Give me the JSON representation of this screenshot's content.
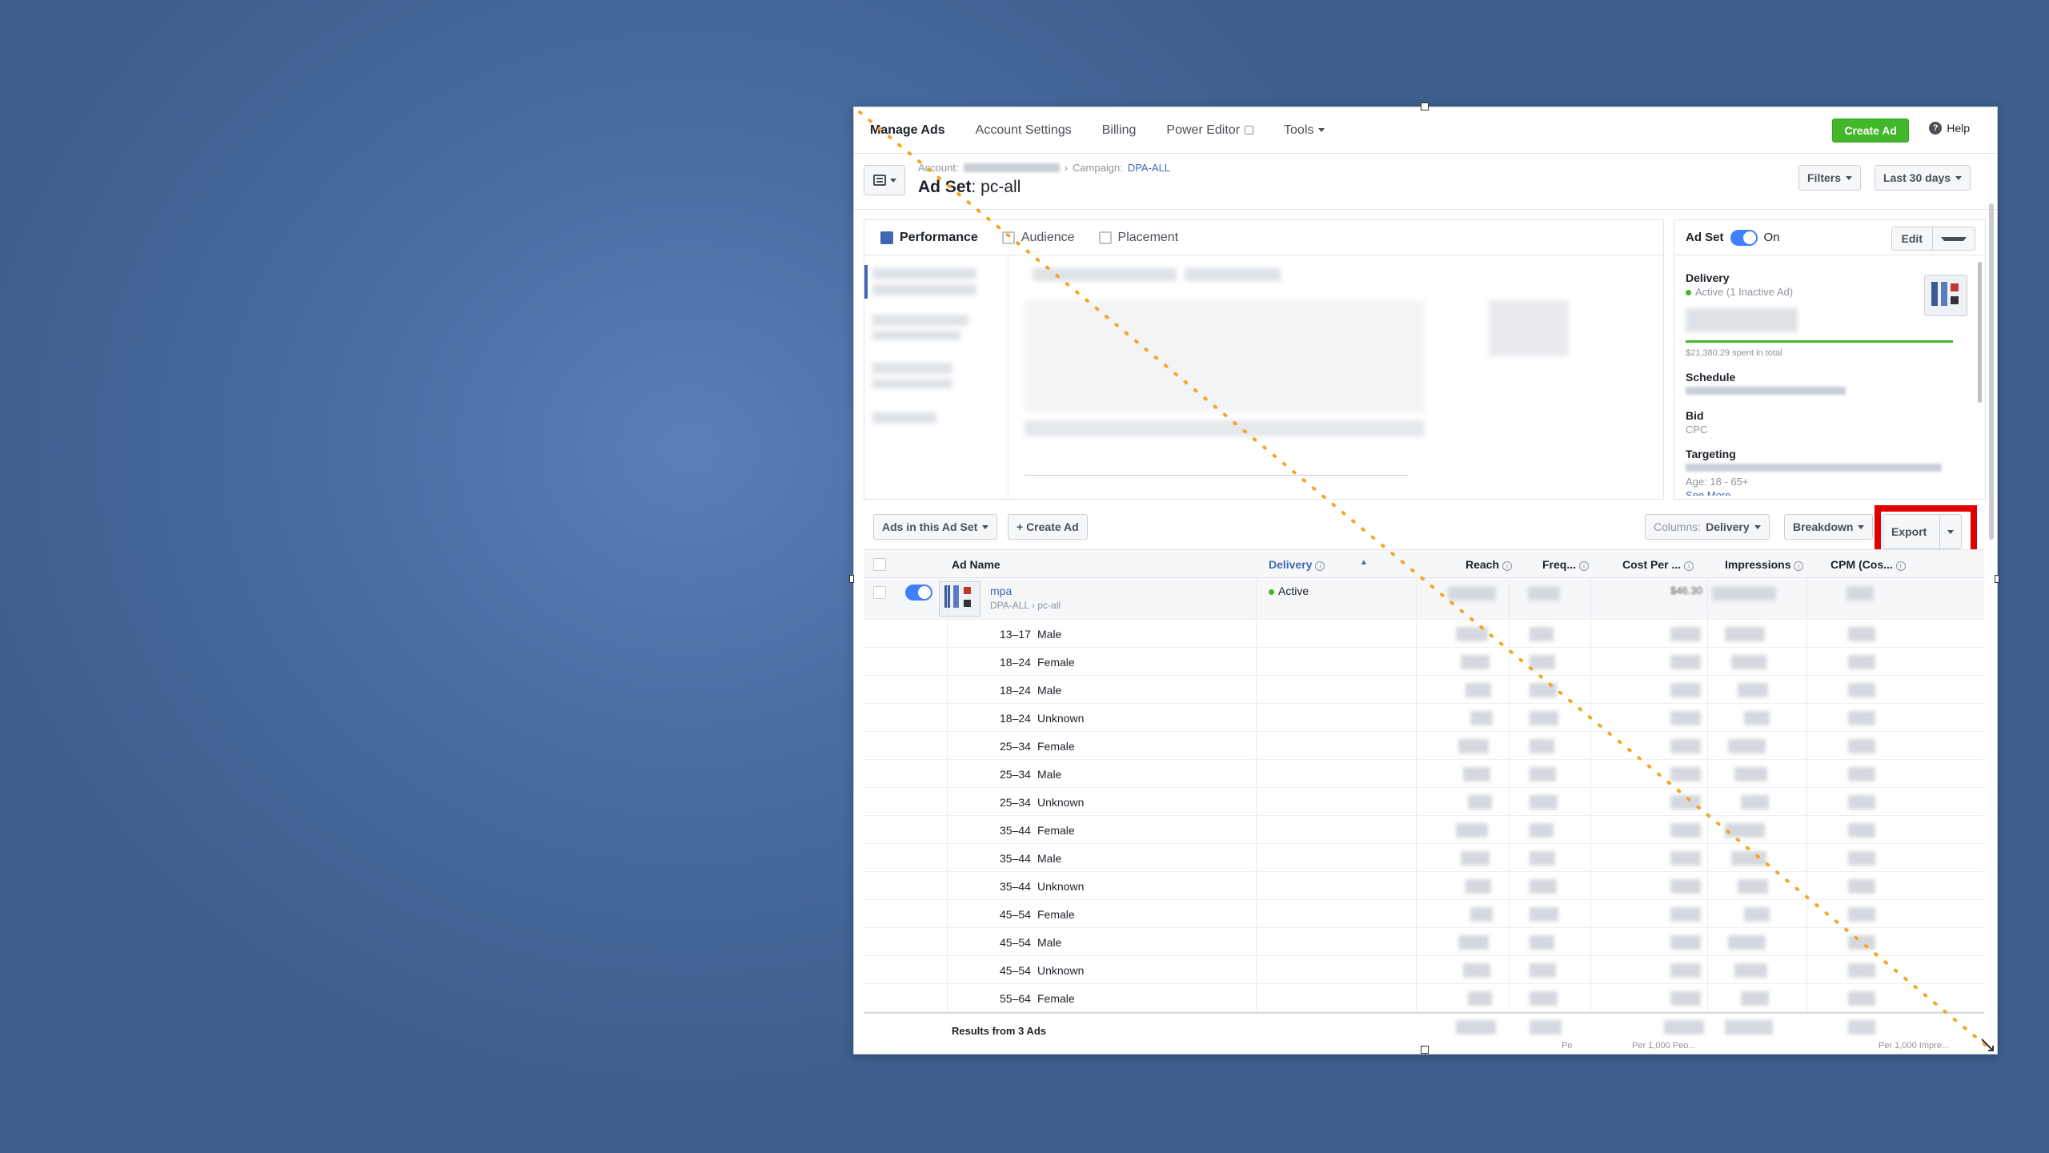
{
  "nav": {
    "items": [
      "Manage Ads",
      "Account Settings",
      "Billing",
      "Power Editor",
      "Tools"
    ],
    "create_ad": "Create Ad",
    "help": "Help"
  },
  "header": {
    "account_label": "Account:",
    "campaign_label": "Campaign:",
    "campaign_name": "DPA-ALL",
    "adset_label": "Ad Set",
    "adset_name": ": pc-all",
    "filters": "Filters",
    "date_range": "Last 30 days"
  },
  "tabs": [
    "Performance",
    "Audience",
    "Placement"
  ],
  "sidebar": {
    "title": "Ad Set",
    "status": "On",
    "edit": "Edit",
    "delivery_label": "Delivery",
    "delivery_value": "Active (1 Inactive Ad)",
    "spent": "$21,380.29 spent in total",
    "spend_progress": 1.0,
    "schedule_label": "Schedule",
    "bid_label": "Bid",
    "bid_value": "CPC",
    "targeting_label": "Targeting",
    "age_value": "Age: 18 - 65+",
    "see_more": "See More"
  },
  "toolbar": {
    "ads_in_set": "Ads in this Ad Set",
    "create_ad": "+ Create Ad",
    "columns_label": "Columns:",
    "columns_value": "Delivery",
    "breakdown": "Breakdown",
    "export": "Export"
  },
  "table": {
    "columns": [
      "Ad Name",
      "Delivery",
      "Reach",
      "Freq...",
      "Cost Per ...",
      "Impressions",
      "CPM (Cos..."
    ],
    "main_row": {
      "name": "mpa",
      "path_campaign": "DPA-ALL",
      "path_adset": "pc-all",
      "delivery": "Active",
      "cost": "$46.30"
    },
    "rows": [
      {
        "age": "13–17",
        "gender": "Male"
      },
      {
        "age": "18–24",
        "gender": "Female"
      },
      {
        "age": "18–24",
        "gender": "Male"
      },
      {
        "age": "18–24",
        "gender": "Unknown"
      },
      {
        "age": "25–34",
        "gender": "Female"
      },
      {
        "age": "25–34",
        "gender": "Male"
      },
      {
        "age": "25–34",
        "gender": "Unknown"
      },
      {
        "age": "35–44",
        "gender": "Female"
      },
      {
        "age": "35–44",
        "gender": "Male"
      },
      {
        "age": "35–44",
        "gender": "Unknown"
      },
      {
        "age": "45–54",
        "gender": "Female"
      },
      {
        "age": "45–54",
        "gender": "Male"
      },
      {
        "age": "45–54",
        "gender": "Unknown"
      },
      {
        "age": "55–64",
        "gender": "Female"
      }
    ],
    "footer": "Results from 3 Ads",
    "footer_pe": "Pe",
    "footer_cost": "Per 1,000 Peo...",
    "footer_cpm": "Per 1,000 Impre..."
  },
  "colors": {
    "accent": "#4267b2",
    "green": "#42b72a",
    "highlight": "#e00000"
  }
}
